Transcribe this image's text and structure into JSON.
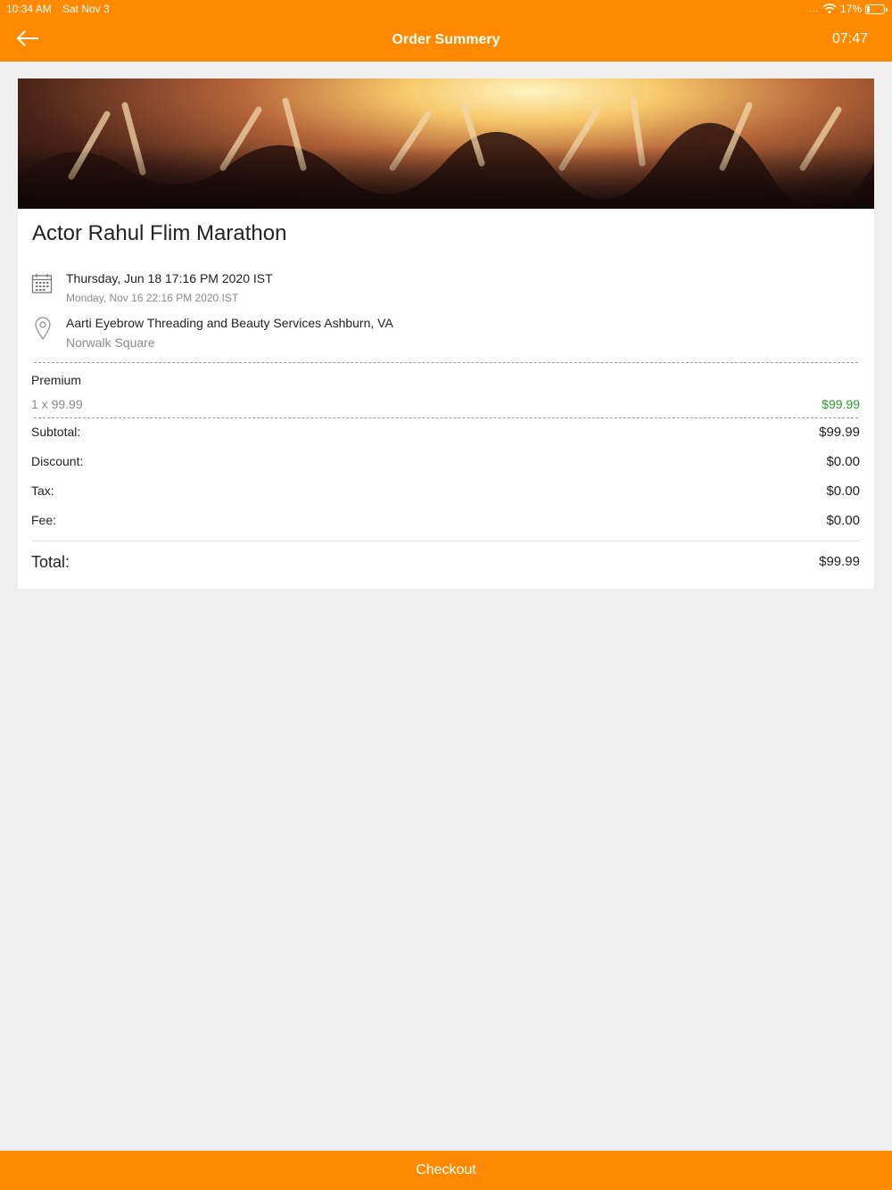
{
  "status_bar": {
    "time": "10:34 AM",
    "date": "Sat Nov 3",
    "signal": "....",
    "battery": "17%",
    "battery_level": 0.17
  },
  "header": {
    "title": "Order Summery",
    "timer": "07:47",
    "back_icon": "arrow-left-icon"
  },
  "event": {
    "title": "Actor Rahul Flim Marathon",
    "start_date": "Thursday, Jun 18 17:16 PM 2020 IST",
    "end_date": "Monday, Nov 16 22:16 PM 2020 IST",
    "venue": "Aarti Eyebrow Threading and Beauty Services Ashburn, VA",
    "venue_sub": "Norwalk Square",
    "calendar_icon": "calendar-icon",
    "location_icon": "location-pin-icon"
  },
  "ticket": {
    "name": "Premium",
    "quantity_line": "1 x 99.99",
    "price": "$99.99"
  },
  "summary": {
    "subtotal_label": "Subtotal:",
    "subtotal_value": "$99.99",
    "discount_label": "Discount:",
    "discount_value": "$0.00",
    "tax_label": "Tax:",
    "tax_value": "$0.00",
    "fee_label": "Fee:",
    "fee_value": "$0.00",
    "total_label": "Total:",
    "total_value": "$99.99"
  },
  "footer": {
    "checkout_label": "Checkout"
  },
  "colors": {
    "brand": "#ff8a00",
    "price_green": "#2a9d2a",
    "background": "#efefef"
  }
}
